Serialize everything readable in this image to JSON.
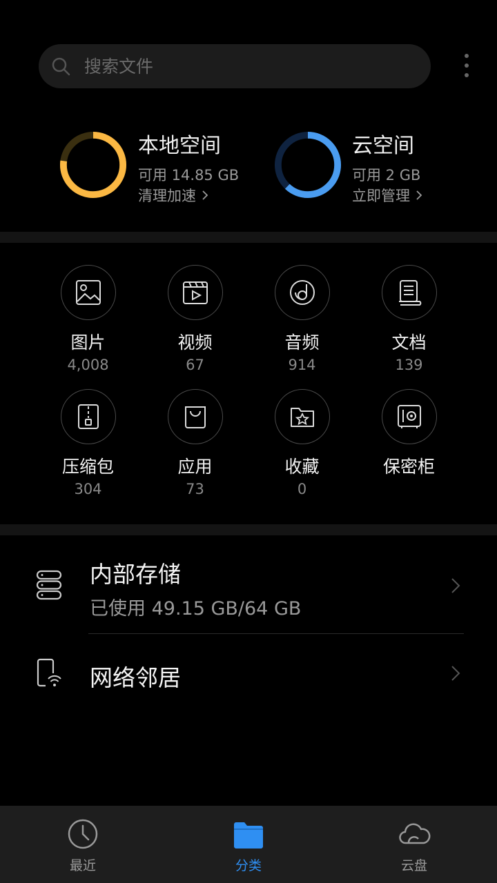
{
  "search": {
    "placeholder": "搜索文件"
  },
  "storage_cards": [
    {
      "title": "本地空间",
      "available": "可用 14.85 GB",
      "action": "清理加速",
      "ring_color": "#fbb843",
      "ring_track": "#3a2f10",
      "used_fraction": 0.77
    },
    {
      "title": "云空间",
      "available": "可用 2 GB",
      "action": "立即管理",
      "ring_color": "#4a9cf0",
      "ring_track": "#0f2340",
      "used_fraction": 0.62
    }
  ],
  "categories": [
    {
      "label": "图片",
      "count": "4,008",
      "icon": "image-icon"
    },
    {
      "label": "视频",
      "count": "67",
      "icon": "video-icon"
    },
    {
      "label": "音频",
      "count": "914",
      "icon": "music-icon"
    },
    {
      "label": "文档",
      "count": "139",
      "icon": "document-icon"
    },
    {
      "label": "压缩包",
      "count": "304",
      "icon": "zip-icon"
    },
    {
      "label": "应用",
      "count": "73",
      "icon": "shopping-bag-icon"
    },
    {
      "label": "收藏",
      "count": "0",
      "icon": "star-folder-icon"
    },
    {
      "label": "保密柜",
      "count": "",
      "icon": "safe-icon"
    }
  ],
  "locations": [
    {
      "title": "内部存储",
      "subtitle": "已使用 49.15 GB/64 GB",
      "icon": "storage-icon"
    },
    {
      "title": "网络邻居",
      "subtitle": "",
      "icon": "network-device-icon"
    }
  ],
  "nav": [
    {
      "label": "最近",
      "icon": "clock-icon",
      "active": false
    },
    {
      "label": "分类",
      "icon": "folder-icon",
      "active": true
    },
    {
      "label": "云盘",
      "icon": "cloud-icon",
      "active": false
    }
  ],
  "colors": {
    "accent": "#2f8ff2",
    "background": "#000000"
  }
}
